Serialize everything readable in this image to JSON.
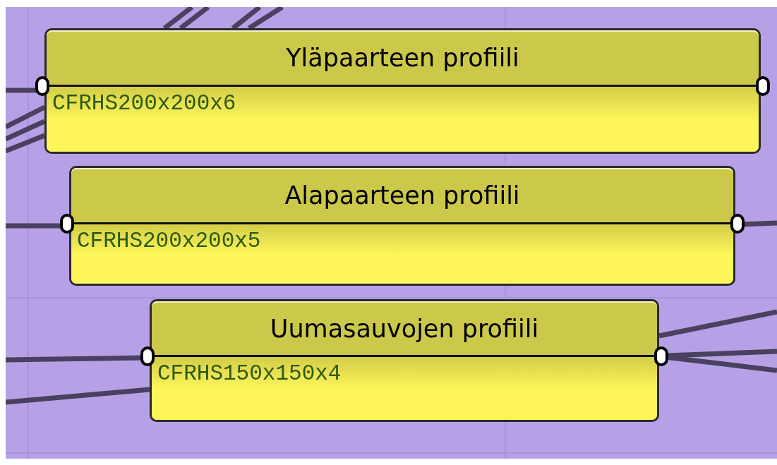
{
  "panels": [
    {
      "title": "Yläpaarteen profiili",
      "value": "CFRHS200x200x6"
    },
    {
      "title": "Alapaarteen profiili",
      "value": "CFRHS200x200x5"
    },
    {
      "title": "Uumasauvojen profiili",
      "value": "CFRHS150x150x4"
    }
  ]
}
